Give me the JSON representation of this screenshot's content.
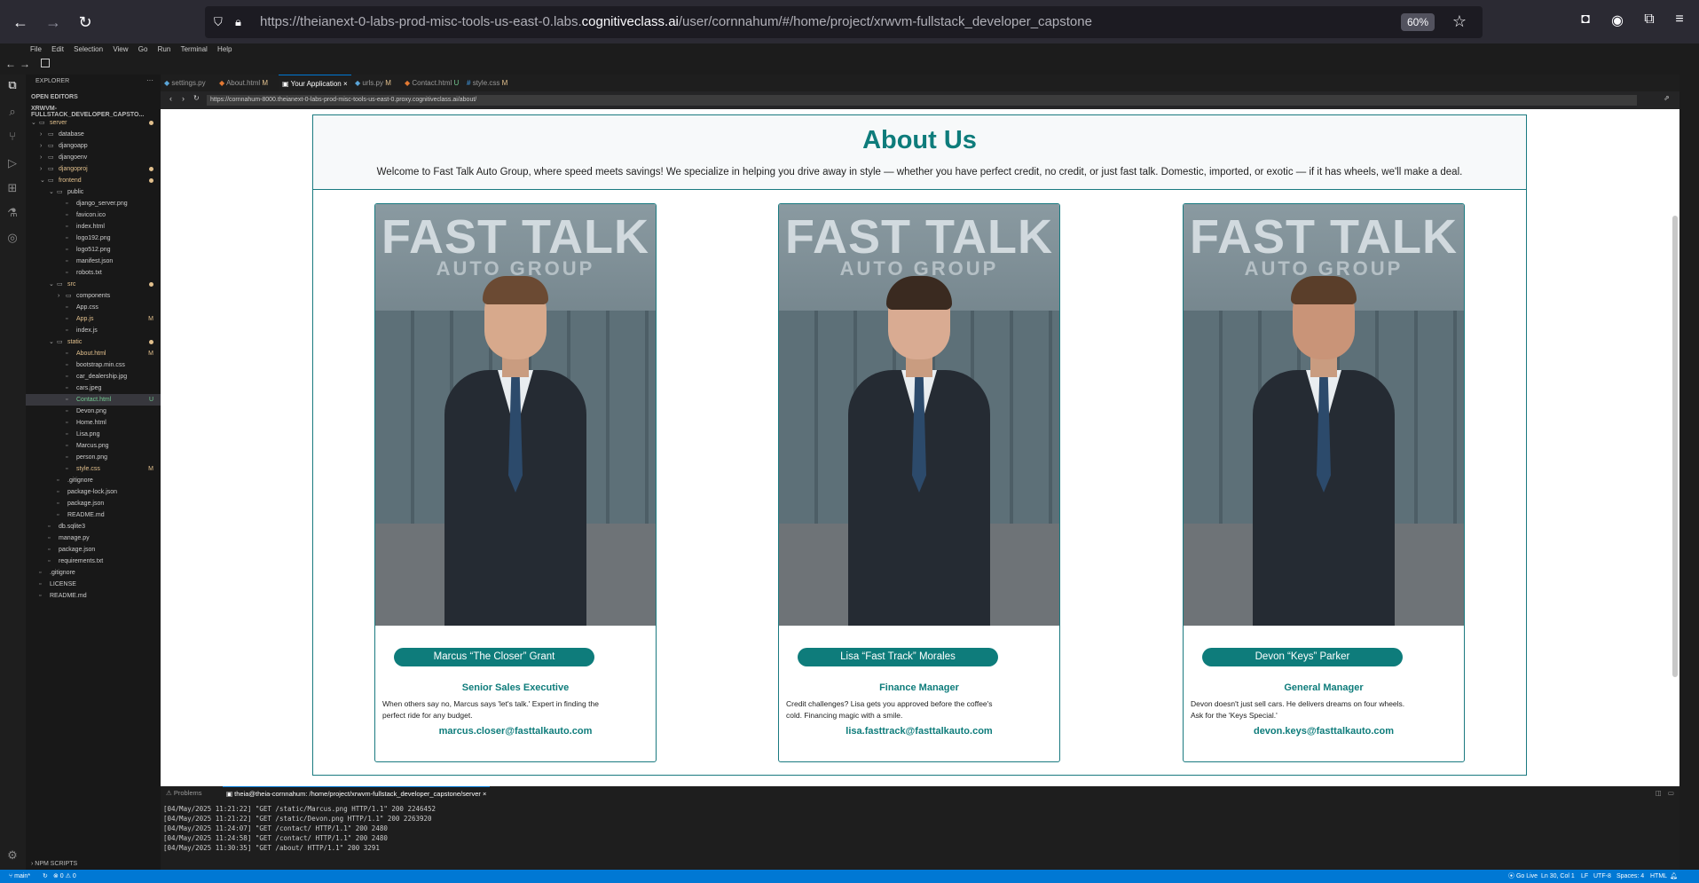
{
  "browser": {
    "url_prefix": "https://theianext-0-labs-prod-misc-tools-us-east-0.labs.",
    "url_domain": "cognitiveclass.ai",
    "url_suffix": "/user/cornnahum/#/home/project/xrwvm-fullstack_developer_capstone",
    "zoom": "60%"
  },
  "menu": [
    "File",
    "Edit",
    "Selection",
    "View",
    "Go",
    "Run",
    "Terminal",
    "Help"
  ],
  "explorer": {
    "title": "EXPLORER",
    "open_editors": "OPEN EDITORS",
    "project": "XRWVM-FULLSTACK_DEVELOPER_CAPSTO...",
    "items": [
      {
        "label": "server",
        "indent": 0,
        "kind": "folder",
        "open": true,
        "color": "#e2c08d",
        "mark": "dot"
      },
      {
        "label": "database",
        "indent": 1,
        "kind": "folder",
        "open": false,
        "color": "#ccc",
        "mark": ""
      },
      {
        "label": "djangoapp",
        "indent": 1,
        "kind": "folder",
        "open": false,
        "color": "#ccc",
        "mark": ""
      },
      {
        "label": "djangoenv",
        "indent": 1,
        "kind": "folder",
        "open": false,
        "color": "#ccc",
        "mark": ""
      },
      {
        "label": "djangoproj",
        "indent": 1,
        "kind": "folder",
        "open": false,
        "color": "#e2c08d",
        "mark": "dot"
      },
      {
        "label": "frontend",
        "indent": 1,
        "kind": "folder",
        "open": true,
        "color": "#e2c08d",
        "mark": "dot"
      },
      {
        "label": "public",
        "indent": 2,
        "kind": "folder",
        "open": true,
        "color": "#ccc",
        "mark": ""
      },
      {
        "label": "django_server.png",
        "indent": 3,
        "kind": "file",
        "color": "#ccc",
        "mark": ""
      },
      {
        "label": "favicon.ico",
        "indent": 3,
        "kind": "file",
        "color": "#ccc",
        "mark": ""
      },
      {
        "label": "index.html",
        "indent": 3,
        "kind": "file",
        "color": "#ccc",
        "mark": ""
      },
      {
        "label": "logo192.png",
        "indent": 3,
        "kind": "file",
        "color": "#ccc",
        "mark": ""
      },
      {
        "label": "logo512.png",
        "indent": 3,
        "kind": "file",
        "color": "#ccc",
        "mark": ""
      },
      {
        "label": "manifest.json",
        "indent": 3,
        "kind": "file",
        "color": "#ccc",
        "mark": ""
      },
      {
        "label": "robots.txt",
        "indent": 3,
        "kind": "file",
        "color": "#ccc",
        "mark": ""
      },
      {
        "label": "src",
        "indent": 2,
        "kind": "folder",
        "open": true,
        "color": "#e2c08d",
        "mark": "dot"
      },
      {
        "label": "components",
        "indent": 3,
        "kind": "folder",
        "open": false,
        "color": "#ccc",
        "mark": ""
      },
      {
        "label": "App.css",
        "indent": 3,
        "kind": "file",
        "color": "#ccc",
        "mark": ""
      },
      {
        "label": "App.js",
        "indent": 3,
        "kind": "file",
        "color": "#e2c08d",
        "mark": "M"
      },
      {
        "label": "index.js",
        "indent": 3,
        "kind": "file",
        "color": "#ccc",
        "mark": ""
      },
      {
        "label": "static",
        "indent": 2,
        "kind": "folder",
        "open": true,
        "color": "#e2c08d",
        "mark": "dot"
      },
      {
        "label": "About.html",
        "indent": 3,
        "kind": "file",
        "color": "#e2c08d",
        "mark": "M"
      },
      {
        "label": "bootstrap.min.css",
        "indent": 3,
        "kind": "file",
        "color": "#ccc",
        "mark": ""
      },
      {
        "label": "car_dealership.jpg",
        "indent": 3,
        "kind": "file",
        "color": "#ccc",
        "mark": ""
      },
      {
        "label": "cars.jpeg",
        "indent": 3,
        "kind": "file",
        "color": "#ccc",
        "mark": ""
      },
      {
        "label": "Contact.html",
        "indent": 3,
        "kind": "file",
        "color": "#73c991",
        "mark": "U",
        "selected": true
      },
      {
        "label": "Devon.png",
        "indent": 3,
        "kind": "file",
        "color": "#ccc",
        "mark": ""
      },
      {
        "label": "Home.html",
        "indent": 3,
        "kind": "file",
        "color": "#ccc",
        "mark": ""
      },
      {
        "label": "Lisa.png",
        "indent": 3,
        "kind": "file",
        "color": "#ccc",
        "mark": ""
      },
      {
        "label": "Marcus.png",
        "indent": 3,
        "kind": "file",
        "color": "#ccc",
        "mark": ""
      },
      {
        "label": "person.png",
        "indent": 3,
        "kind": "file",
        "color": "#ccc",
        "mark": ""
      },
      {
        "label": "style.css",
        "indent": 3,
        "kind": "file",
        "color": "#e2c08d",
        "mark": "M"
      },
      {
        "label": ".gitignore",
        "indent": 2,
        "kind": "file",
        "color": "#ccc",
        "mark": ""
      },
      {
        "label": "package-lock.json",
        "indent": 2,
        "kind": "file",
        "color": "#ccc",
        "mark": ""
      },
      {
        "label": "package.json",
        "indent": 2,
        "kind": "file",
        "color": "#ccc",
        "mark": ""
      },
      {
        "label": "README.md",
        "indent": 2,
        "kind": "file",
        "color": "#ccc",
        "mark": ""
      },
      {
        "label": "db.sqlite3",
        "indent": 1,
        "kind": "file",
        "color": "#ccc",
        "mark": ""
      },
      {
        "label": "manage.py",
        "indent": 1,
        "kind": "file",
        "color": "#ccc",
        "mark": ""
      },
      {
        "label": "package.json",
        "indent": 1,
        "kind": "file",
        "color": "#ccc",
        "mark": ""
      },
      {
        "label": "requirements.txt",
        "indent": 1,
        "kind": "file",
        "color": "#ccc",
        "mark": ""
      },
      {
        "label": ".gitignore",
        "indent": 0,
        "kind": "file",
        "color": "#ccc",
        "mark": ""
      },
      {
        "label": "LICENSE",
        "indent": 0,
        "kind": "file",
        "color": "#ccc",
        "mark": ""
      },
      {
        "label": "README.md",
        "indent": 0,
        "kind": "file",
        "color": "#ccc",
        "mark": ""
      }
    ],
    "npm_scripts": "NPM SCRIPTS"
  },
  "tabs": [
    {
      "label": "settings.py",
      "mark": ""
    },
    {
      "label": "About.html",
      "mark": "M"
    },
    {
      "label": "Your Application",
      "mark": "×",
      "active": true
    },
    {
      "label": "urls.py",
      "mark": "M"
    },
    {
      "label": "Contact.html",
      "mark": "U"
    },
    {
      "label": "style.css",
      "mark": "M"
    }
  ],
  "preview_url": "https://cornnahum-8000.theianext-0-labs-prod-misc-tools-us-east-0.proxy.cognitiveclass.ai/about/",
  "about": {
    "title": "About Us",
    "intro": "Welcome to Fast Talk Auto Group, where speed meets savings! We specialize in helping you drive away in style — whether you have perfect credit, no credit, or just fast talk. Domestic, imported, or exotic — if it has wheels, we'll make a deal.",
    "sign_main": "FAST TALK",
    "sign_sub": "AUTO GROUP",
    "team": [
      {
        "name": "Marcus “The Closer” Grant",
        "role": "Senior Sales Executive",
        "bio": "When others say no, Marcus says 'let's talk.' Expert in finding the perfect ride for any budget.",
        "email": "marcus.closer@fasttalkauto.com"
      },
      {
        "name": "Lisa “Fast Track” Morales",
        "role": "Finance Manager",
        "bio": "Credit challenges? Lisa gets you approved before the coffee's cold. Financing magic with a smile.",
        "email": "lisa.fasttrack@fasttalkauto.com"
      },
      {
        "name": "Devon “Keys” Parker",
        "role": "General Manager",
        "bio": "Devon doesn't just sell cars. He delivers dreams on four wheels. Ask for the 'Keys Special.'",
        "email": "devon.keys@fasttalkauto.com"
      }
    ]
  },
  "panel": {
    "problems_tab": "Problems",
    "terminal_tab": "theia@theia-cornnahum: /home/project/xrwvm-fullstack_developer_capstone/server",
    "log": [
      "[04/May/2025 11:21:22] \"GET /static/Marcus.png HTTP/1.1\" 200 2246452",
      "[04/May/2025 11:21:22] \"GET /static/Devon.png HTTP/1.1\" 200 2263920",
      "[04/May/2025 11:24:07] \"GET /contact/ HTTP/1.1\" 200 2480",
      "[04/May/2025 11:24:58] \"GET /contact/ HTTP/1.1\" 200 2480",
      "[04/May/2025 11:30:35] \"GET /about/ HTTP/1.1\" 200 3291"
    ]
  },
  "status": {
    "branch": "main*",
    "problems": "⊗ 0 ⚠ 0",
    "go_live": "Go Live",
    "position": "Ln 30, Col 1",
    "eol": "LF",
    "encoding": "UTF-8",
    "spaces": "Spaces: 4",
    "lang": "HTML"
  }
}
